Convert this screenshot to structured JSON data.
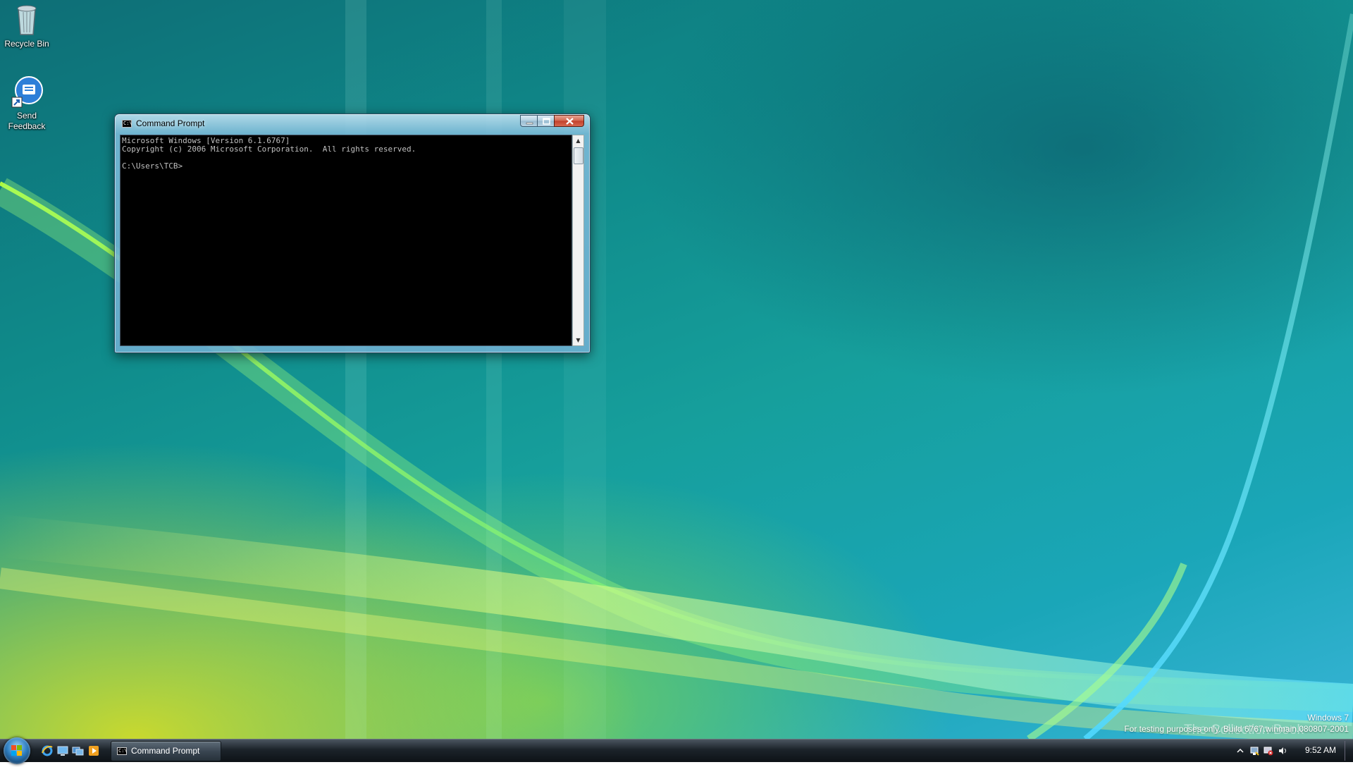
{
  "desktop": {
    "icons": [
      {
        "label": "Recycle Bin",
        "icon": "recycle-bin-icon"
      },
      {
        "label": "Send Feedback",
        "icon": "feedback-icon"
      }
    ]
  },
  "window": {
    "title": "Command Prompt",
    "console_lines": [
      "Microsoft Windows [Version 6.1.6767]",
      "Copyright (c) 2006 Microsoft Corporation.  All rights reserved.",
      "",
      "C:\\Users\\TCB>"
    ]
  },
  "watermark": {
    "line1": "Windows 7",
    "line2": "For testing purposes only. Build 6767.winmain.080807-2001",
    "logo_text": "The Collection Book"
  },
  "taskbar": {
    "quick_launch": [
      "internet-explorer-icon",
      "show-desktop-icon",
      "switch-windows-icon",
      "media-player-icon"
    ],
    "task_label": "Command Prompt",
    "tray_icons": [
      "show-hidden-icons-icon",
      "network-icon",
      "action-center-icon",
      "volume-icon"
    ],
    "clock": "9:52 AM"
  }
}
